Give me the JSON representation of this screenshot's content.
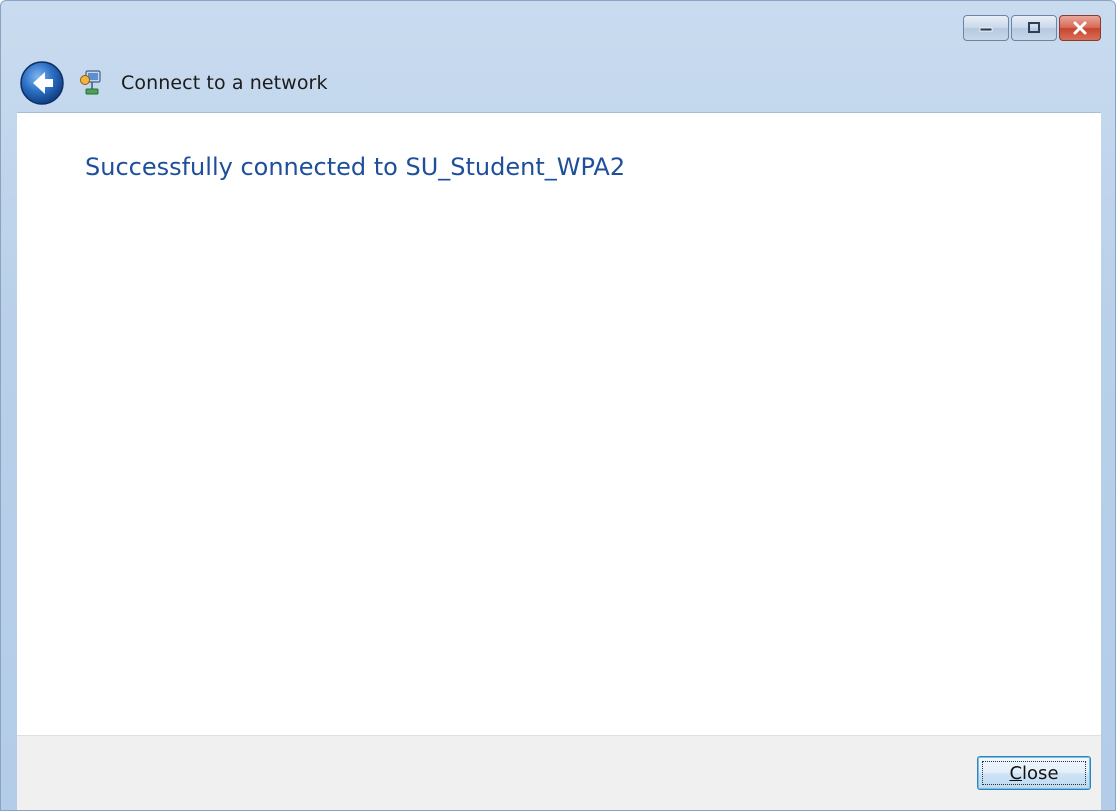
{
  "window": {
    "title": "Connect to a network"
  },
  "message": {
    "heading": "Successfully connected to SU_Student_WPA2"
  },
  "footer": {
    "close_label_access_key": "C",
    "close_label_rest": "lose"
  },
  "colors": {
    "heading_text": "#1d4f9a",
    "titlebar": "#b9d0ea",
    "footer_bg": "#f0f0f0"
  },
  "icons": {
    "back": "back-arrow-icon",
    "network": "network-icon",
    "minimize": "minimize-icon",
    "maximize": "maximize-icon",
    "close": "close-icon"
  }
}
